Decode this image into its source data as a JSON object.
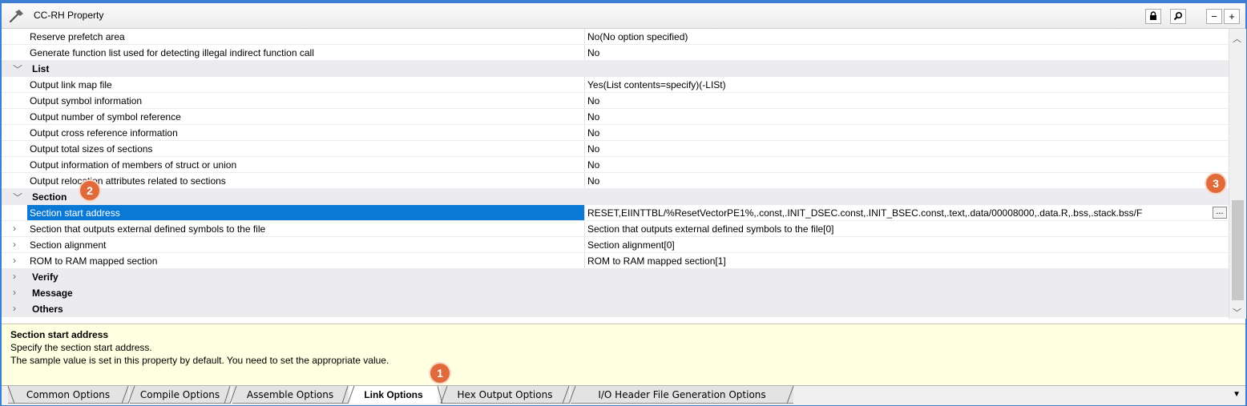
{
  "window": {
    "title": "CC-RH Property"
  },
  "titlebar_buttons": {
    "lock": "lock-icon",
    "search": "search-icon",
    "collapse": "−",
    "expand": "+"
  },
  "rows": [
    {
      "type": "prop",
      "name": "Reserve prefetch area",
      "value": "No(No option specified)"
    },
    {
      "type": "prop",
      "name": "Generate function list used for detecting illegal indirect function call",
      "value": "No"
    },
    {
      "type": "cat",
      "name": "List",
      "expanded": true
    },
    {
      "type": "prop",
      "name": "Output link map file",
      "value": "Yes(List contents=specify)(-LISt)"
    },
    {
      "type": "prop",
      "name": "Output symbol information",
      "value": "No"
    },
    {
      "type": "prop",
      "name": "Output number of symbol reference",
      "value": "No"
    },
    {
      "type": "prop",
      "name": "Output cross reference information",
      "value": "No"
    },
    {
      "type": "prop",
      "name": "Output total sizes of sections",
      "value": "No"
    },
    {
      "type": "prop",
      "name": "Output information of members of struct or union",
      "value": "No"
    },
    {
      "type": "prop",
      "name": "Output relocation attributes related to sections",
      "value": "No"
    },
    {
      "type": "cat",
      "name": "Section",
      "expanded": true
    },
    {
      "type": "prop",
      "name": "Section start address",
      "value": "RESET,EIINTTBL/%ResetVectorPE1%,.const,.INIT_DSEC.const,.INIT_BSEC.const,.text,.data/00008000,.data.R,.bss,.stack.bss/F",
      "selected": true,
      "button": "..."
    },
    {
      "type": "sub",
      "name": "Section that outputs external defined symbols to the file",
      "value": "Section that outputs external defined symbols to the file[0]"
    },
    {
      "type": "sub",
      "name": "Section alignment",
      "value": "Section alignment[0]"
    },
    {
      "type": "sub",
      "name": "ROM to RAM mapped section",
      "value": "ROM to RAM mapped section[1]"
    },
    {
      "type": "cat",
      "name": "Verify",
      "expanded": false
    },
    {
      "type": "cat",
      "name": "Message",
      "expanded": false
    },
    {
      "type": "cat",
      "name": "Others",
      "expanded": false
    }
  ],
  "description": {
    "title": "Section start address",
    "line1": "Specify the section start address.",
    "line2": "The sample value is set in this property by default. You need to set the appropriate value."
  },
  "tabs": [
    {
      "label": "Common Options",
      "active": false
    },
    {
      "label": "Compile Options",
      "active": false
    },
    {
      "label": "Assemble Options",
      "active": false
    },
    {
      "label": "Link Options",
      "active": true
    },
    {
      "label": "Hex Output Options",
      "active": false
    },
    {
      "label": "I/O Header File Generation Options",
      "active": false
    }
  ],
  "callouts": [
    "1",
    "2",
    "3"
  ],
  "colors": {
    "selection": "#0a79d6",
    "category_bg": "#ececf0",
    "description_bg": "#ffffe1",
    "callout": "#e06a3a",
    "frame": "#3c7fd1"
  }
}
